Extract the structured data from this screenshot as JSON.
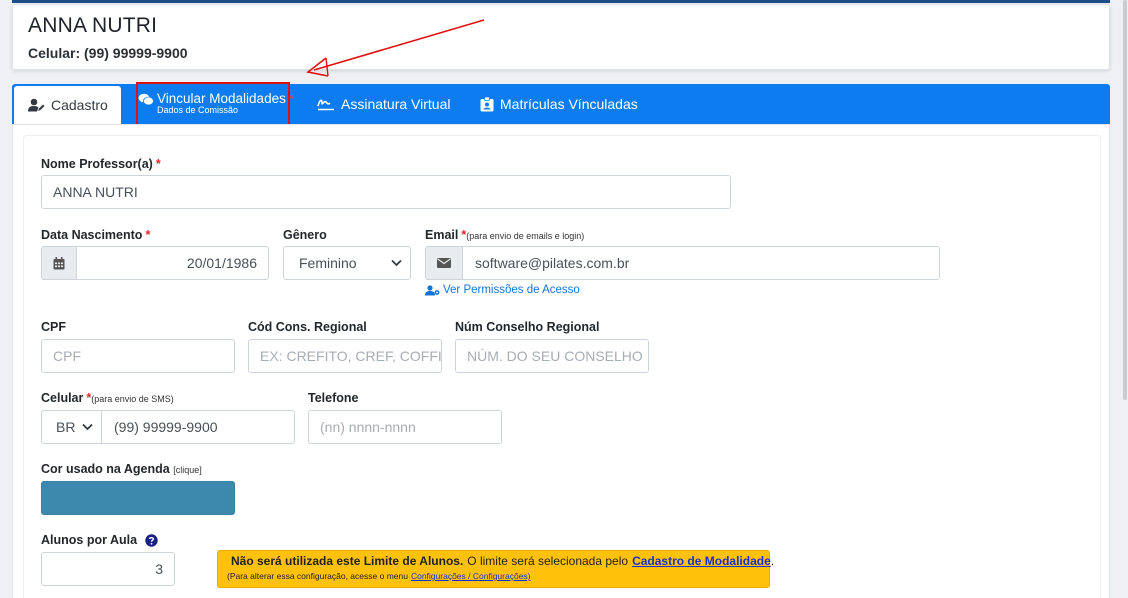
{
  "header": {
    "name": "ANNA NUTRI",
    "phone": "Celular: (99) 99999-9900"
  },
  "tabs": [
    {
      "label": "Cadastro",
      "icon": "user-edit-icon"
    },
    {
      "label": "Vincular Modalidades",
      "sub": "Dados de Comissão",
      "required": "*",
      "icon": "comments-icon"
    },
    {
      "label": "Assinatura Virtual",
      "icon": "signature-icon"
    },
    {
      "label": "Matrículas Vínculadas",
      "icon": "id-badge-icon"
    }
  ],
  "form": {
    "nome": {
      "label": "Nome Professor(a)",
      "required": "*",
      "value": "ANNA NUTRI"
    },
    "nascimento": {
      "label": "Data Nascimento",
      "required": "*",
      "value": "20/01/1986"
    },
    "genero": {
      "label": "Gênero",
      "value": "Feminino"
    },
    "email": {
      "label": "Email",
      "required": "*",
      "note": "(para envio de emails e login)",
      "value": "software@pilates.com.br",
      "link": "Ver Permissões de Acesso"
    },
    "cpf": {
      "label": "CPF",
      "placeholder": "CPF"
    },
    "cod_cons": {
      "label": "Cód Cons. Regional",
      "placeholder": "EX: CREFITO, CREF, COFFITO"
    },
    "num_cons": {
      "label": "Núm Conselho Regional",
      "placeholder": "NÚM. DO SEU CONSELHO"
    },
    "celular": {
      "label": "Celular",
      "required": "*",
      "note": "(para envio de SMS)",
      "country": "BR",
      "value": "(99) 99999-9900"
    },
    "telefone": {
      "label": "Telefone",
      "placeholder": "(nn) nnnn-nnnn"
    },
    "cor": {
      "label": "Cor usado na Agenda",
      "note": "[clique]",
      "color": "#3d88ad"
    },
    "alunos": {
      "label": "Alunos por Aula",
      "value": "3"
    }
  },
  "alert": {
    "bold": "Não será utilizada este Limite de Alunos.",
    "text": "O limite será selecionada pelo",
    "link": "Cadastro de Modalidade",
    "end": ".",
    "small": "(Para alterar essa configuração, acesse o menu",
    "small_link": "Configurações / Configurações)"
  },
  "colors": {
    "tabbar": "#0d7cf0",
    "annotation": "#e01010",
    "alert": "#ffc10a"
  }
}
